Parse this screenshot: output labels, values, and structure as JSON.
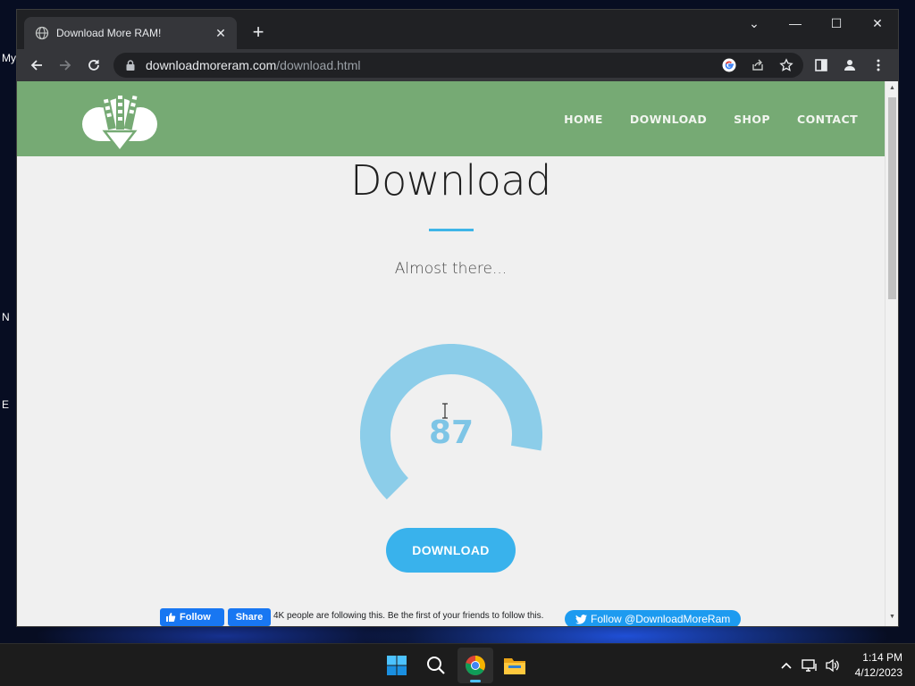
{
  "desktop": {
    "icon_labels": [
      "My",
      "N",
      "E"
    ]
  },
  "browser": {
    "tab": {
      "title": "Download More RAM!"
    },
    "window_controls": {
      "tab_search": "⌄",
      "minimize": "—",
      "maximize": "☐",
      "close": "✕"
    },
    "address": {
      "host": "downloadmoreram.com",
      "path": "/download.html"
    }
  },
  "site": {
    "nav": [
      "HOME",
      "DOWNLOAD",
      "SHOP",
      "CONTACT"
    ],
    "title": "Download",
    "subtitle": "Almost there...",
    "progress": {
      "value": "87",
      "fraction": 0.87,
      "color": "#8ccde9"
    },
    "download_button": "DOWNLOAD",
    "social": {
      "fb_follow": "Follow",
      "fb_share": "Share",
      "fb_text": "4K people are following this. Be the first of your friends to follow this.",
      "twitter_follow": "Follow @DownloadMoreRam"
    },
    "colors": {
      "header": "#76aa74",
      "accent": "#3eb5e8",
      "button": "#39b2ec"
    }
  },
  "taskbar": {
    "apps": [
      "windows-start",
      "search",
      "chrome",
      "file-explorer"
    ],
    "clock": {
      "time": "1:14 PM",
      "date": "4/12/2023"
    }
  }
}
